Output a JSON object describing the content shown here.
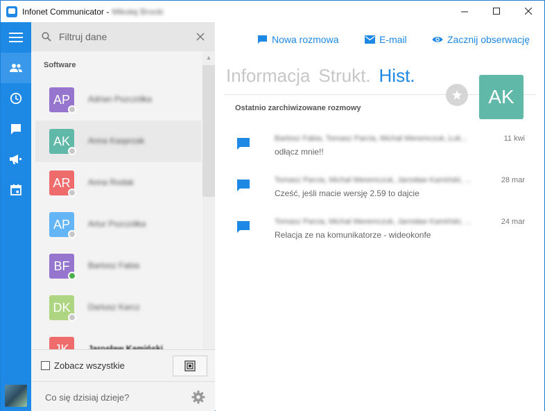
{
  "window": {
    "title": "Infonet Communicator -",
    "title_user": "Mikołaj Brocki"
  },
  "search": {
    "placeholder": "Filtruj dane"
  },
  "contacts": {
    "group": "Software",
    "items": [
      {
        "initials": "AP",
        "name": "Adrian Pszczółka",
        "color": "#9575cd",
        "status": "offline"
      },
      {
        "initials": "AK",
        "name": "Anna Kasprzak",
        "color": "#5fb8a8",
        "status": "offline"
      },
      {
        "initials": "AR",
        "name": "Anna Rodak",
        "color": "#ef6c6c",
        "status": "offline"
      },
      {
        "initials": "AP",
        "name": "Artur Pszczółka",
        "color": "#64b5f6",
        "status": "offline"
      },
      {
        "initials": "BF",
        "name": "Bartosz Fabia",
        "color": "#9575cd",
        "status": "online"
      },
      {
        "initials": "DK",
        "name": "Dariusz Karcz",
        "color": "#aed581",
        "status": "offline"
      },
      {
        "initials": "JK",
        "name": "Jarosław Kamiński",
        "color": "#ef6c6c",
        "status": "offline"
      }
    ]
  },
  "footer": {
    "see_all": "Zobacz wszystkie",
    "status_placeholder": "Co się dzisiaj dzieje?"
  },
  "actions": {
    "new_conversation": "Nowa rozmowa",
    "email": "E-mail",
    "observe": "Zacznij obserwację"
  },
  "tabs": {
    "info": "Informacja",
    "struct": "Strukt.",
    "hist": "Hist."
  },
  "profile": {
    "initials": "AK",
    "color": "#5fb8a8"
  },
  "history": {
    "section_label": "Ostatnio zarchiwizowane rozmowy",
    "items": [
      {
        "people": "Bartosz Fabia, Tomasz Parcia, Michał Weremczuk, Łuk...",
        "date": "11 kwi",
        "message": "odłącz mnie!!"
      },
      {
        "people": "Tomasz Parcia, Michał Weremczuk, Jarosław Kamiński, ...",
        "date": "28 mar",
        "message": "Cześć, jeśli macie wersję 2.59 to dajcie"
      },
      {
        "people": "Tomasz Parcia, Michał Weremczuk, Jarosław Kamiński, ...",
        "date": "24 mar",
        "message": "Relacja ze na komunikatorze - wideokonfe"
      }
    ]
  },
  "colors": {
    "accent": "#1e88e5",
    "rail": "#1e88e5",
    "online": "#4caf50",
    "offline": "#c8c8c8"
  },
  "icons": {
    "rail": [
      "hamburger-menu-icon",
      "contacts-icon",
      "clock-icon",
      "chat-icon",
      "megaphone-icon",
      "calendar-icon"
    ],
    "window": [
      "minimize-icon",
      "maximize-icon",
      "close-icon"
    ]
  }
}
